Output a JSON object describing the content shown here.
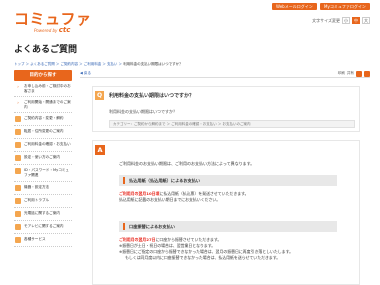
{
  "brand": {
    "logo": "コミュファ",
    "powered_by": "Powered by",
    "ctc": "ctc"
  },
  "header": {
    "btn_web": "Webメールログイン",
    "btn_my": "Myコミュファログイン",
    "size_label": "文字サイズ変更",
    "size_small": "小",
    "size_medium": "中",
    "size_large": "大"
  },
  "page_title": "よくあるご質問",
  "breadcrumb": {
    "items": [
      "トップ",
      "よくあるご質問",
      "ご契約内容",
      "ご利用料金",
      "支払い"
    ],
    "current": "利用料金の支払い期限はいつですか？"
  },
  "sidebar": {
    "heading": "目的から探す",
    "items": [
      {
        "label": "お申し込み前・ご検討中のお客さま"
      },
      {
        "label": "ご利用開始・開通までのご案内"
      },
      {
        "label": "ご契約内容・変更・解約"
      },
      {
        "label": "転居・住所変更のご案内"
      },
      {
        "label": "ご利用料金の確認・お支払い"
      },
      {
        "label": "設定・使い方のご案内"
      },
      {
        "label": "ID・パスワード・Myコミュファ関連"
      },
      {
        "label": "機器・設定方法"
      },
      {
        "label": "ご利用トラブル"
      },
      {
        "label": "光電話に関するご案内"
      },
      {
        "label": "モアレビに関するご案内"
      },
      {
        "label": "各種サービス"
      }
    ]
  },
  "main": {
    "back": "戻る",
    "print": "印刷",
    "share": "共有",
    "question_mark": "Q",
    "question_title": "利用料金の支払い期限はいつですか？",
    "question_text": "利用料金の支払い期限はいつですか？",
    "category": "カテゴリー：ご契約から解約まで ＞ ご利用料金の確認・お支払い ＞ お支払いのご案内",
    "answer_mark": "A",
    "answer_intro": "ご利用料金のお支払い期限は、ご利用のお支払い方法によって異なります。",
    "method1": "払込用紙（払込用紙）によるお支払い",
    "m1_red": "ご利用月の翌月10日頃",
    "m1_rest": "に払込用紙（払込票）を発送させていただきます。",
    "m1_line2": "払込用紙に記載のお支払い期日までにお支払いください。",
    "method2": "口座振替によるお支払い",
    "m2_red": "ご利用月の翌月27日",
    "m2_rest": "に口座から振替させていただきます。",
    "m2_line2": "※振替日が土日・祝日の場合は、翌営業日となります。",
    "m2_line3": "※振替日にご指定の口座から振替できなかった場合は、翌月の振替日に再度引き落としいたします。",
    "m2_line4": "もしくは同月度以内に口座振替できなかった場合は、払込用紙を送らせていただきます。"
  }
}
